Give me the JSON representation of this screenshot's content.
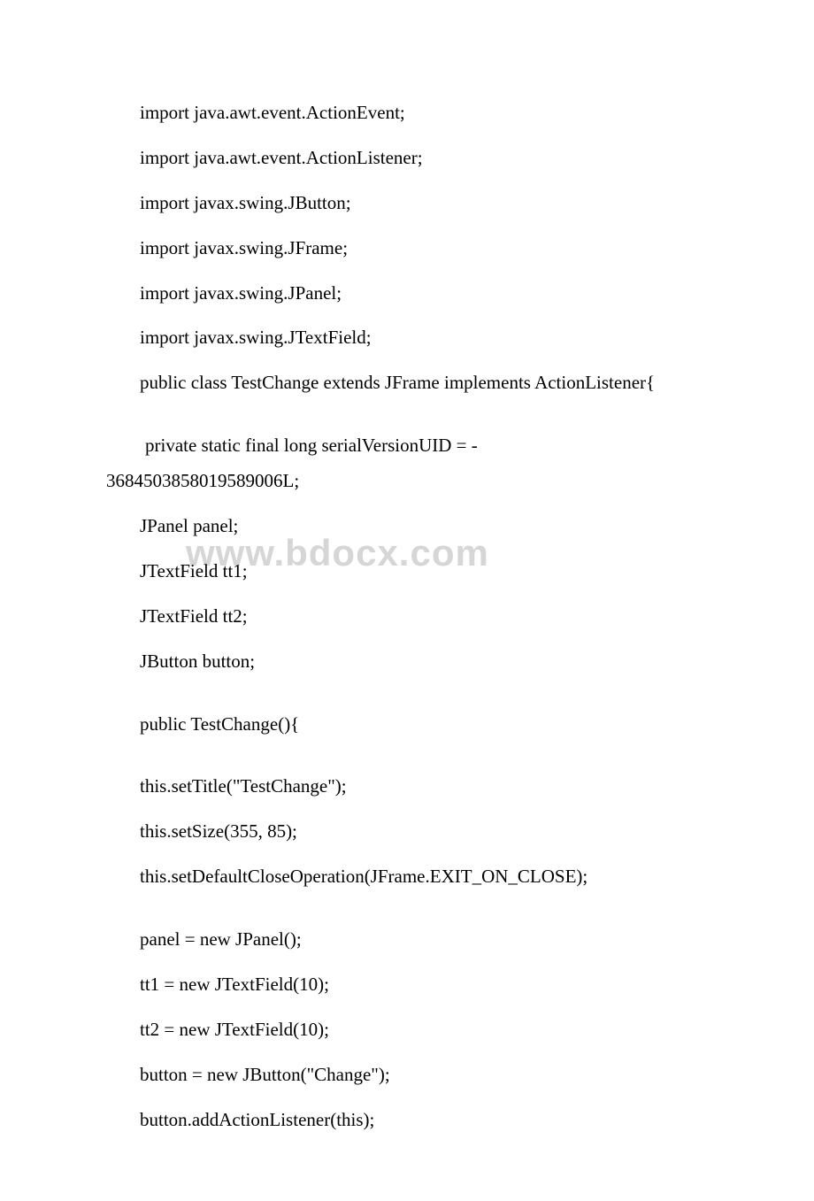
{
  "watermark": "www.bdocx.com",
  "lines": [
    {
      "indent": 1,
      "text": "import java.awt.event.ActionEvent;"
    },
    {
      "indent": 1,
      "text": "import java.awt.event.ActionListener;"
    },
    {
      "indent": 1,
      "text": "import javax.swing.JButton;"
    },
    {
      "indent": 1,
      "text": "import javax.swing.JFrame;"
    },
    {
      "indent": 1,
      "text": "import javax.swing.JPanel;"
    },
    {
      "indent": 1,
      "text": "import javax.swing.JTextField;"
    },
    {
      "indent": 1,
      "text": "public class TestChange extends JFrame implements ActionListener{"
    },
    {
      "indent": -1,
      "text": ""
    },
    {
      "indent": 1,
      "text": " private static final long serialVersionUID = -3684503858019589006L;"
    },
    {
      "indent": 1,
      "text": "JPanel panel;"
    },
    {
      "indent": 1,
      "text": "JTextField tt1;"
    },
    {
      "indent": 1,
      "text": "JTextField tt2;"
    },
    {
      "indent": 1,
      "text": "JButton button;"
    },
    {
      "indent": -1,
      "text": ""
    },
    {
      "indent": 1,
      "text": "public TestChange(){"
    },
    {
      "indent": -1,
      "text": ""
    },
    {
      "indent": 1,
      "text": "this.setTitle(\"TestChange\");"
    },
    {
      "indent": 1,
      "text": "this.setSize(355, 85);"
    },
    {
      "indent": 1,
      "text": "this.setDefaultCloseOperation(JFrame.EXIT_ON_CLOSE);"
    },
    {
      "indent": -1,
      "text": ""
    },
    {
      "indent": 1,
      "text": "panel = new JPanel();"
    },
    {
      "indent": 1,
      "text": "tt1 = new JTextField(10);"
    },
    {
      "indent": 1,
      "text": "tt2 = new JTextField(10);"
    },
    {
      "indent": 1,
      "text": "button = new JButton(\"Change\");"
    },
    {
      "indent": 1,
      "text": "button.addActionListener(this);"
    }
  ]
}
